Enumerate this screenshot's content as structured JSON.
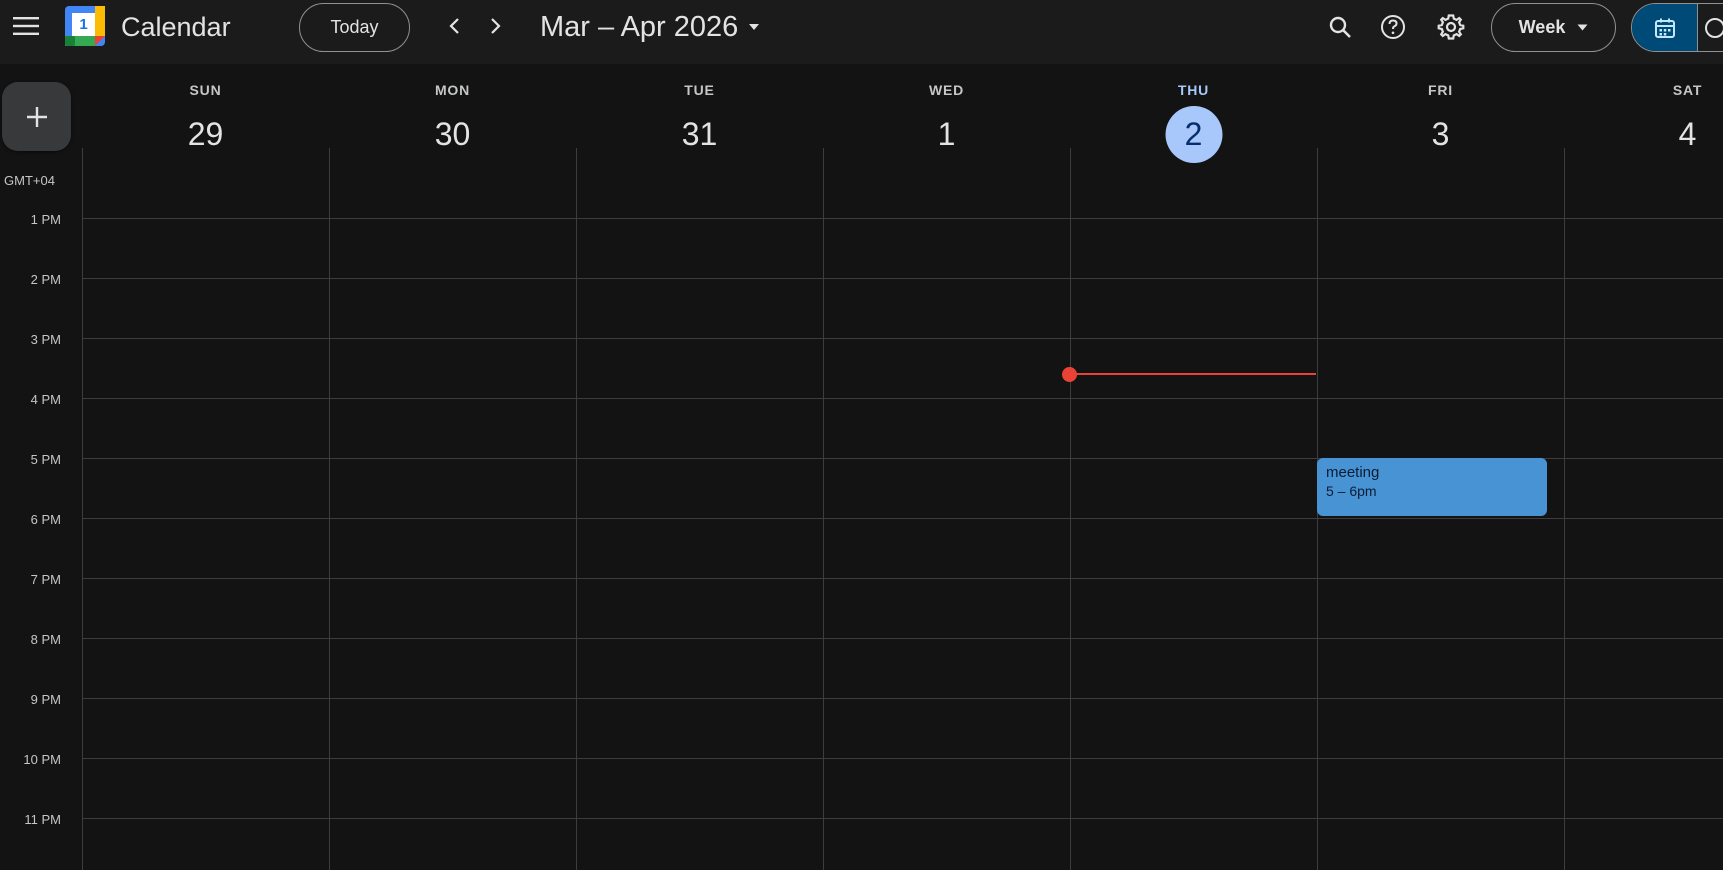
{
  "header": {
    "app_title": "Calendar",
    "logo_day": "1",
    "today_label": "Today",
    "date_range": "Mar – Apr 2026",
    "view_label": "Week"
  },
  "grid": {
    "timezone": "GMT+04",
    "hours": [
      "1 PM",
      "2 PM",
      "3 PM",
      "4 PM",
      "5 PM",
      "6 PM",
      "7 PM",
      "8 PM",
      "9 PM",
      "10 PM",
      "11 PM"
    ]
  },
  "days": [
    {
      "name": "SUN",
      "num": "29"
    },
    {
      "name": "MON",
      "num": "30"
    },
    {
      "name": "TUE",
      "num": "31"
    },
    {
      "name": "WED",
      "num": "1"
    },
    {
      "name": "THU",
      "num": "2",
      "today": true
    },
    {
      "name": "FRI",
      "num": "3"
    },
    {
      "name": "SAT",
      "num": "4"
    }
  ],
  "events": [
    {
      "title": "meeting",
      "time": "5 – 6pm"
    }
  ],
  "colors": {
    "background": "#131314",
    "today_accent": "#a8c7fa",
    "now_line": "#ea4335",
    "event": "#4793d4",
    "view_toggle_active": "#004a77"
  },
  "icons": {
    "menu": "menu-icon",
    "prev": "chevron-left-icon",
    "next": "chevron-right-icon",
    "dropdown": "caret-down-icon",
    "search": "search-icon",
    "help": "help-icon",
    "settings": "gear-icon",
    "calendar_view": "calendar-icon",
    "tasks_view": "check-circle-icon",
    "create": "plus-icon"
  }
}
